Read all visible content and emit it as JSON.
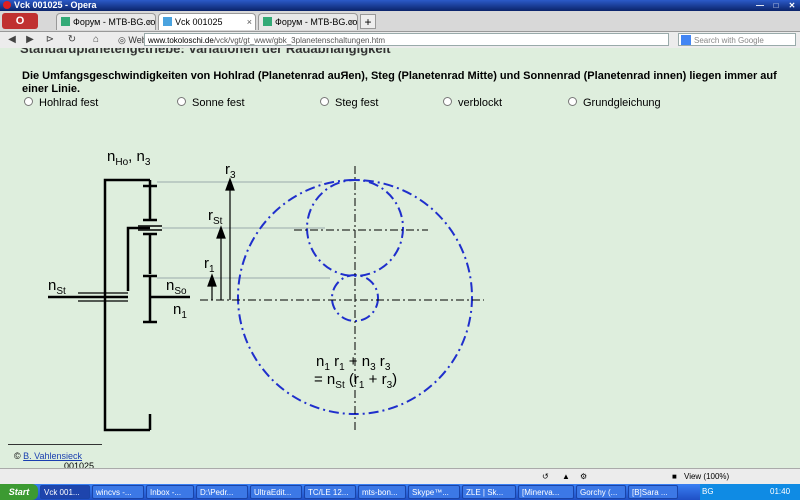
{
  "window": {
    "title": "Vck 001025 - Opera"
  },
  "tabs": [
    {
      "label": "Форум - MTB-BG.com • V..."
    },
    {
      "label": "Vck 001025"
    },
    {
      "label": "Форум - MTB-BG.com • V..."
    }
  ],
  "toolbar": {
    "opera_label": "O",
    "web_label": "Web",
    "address_host": "www.tokoloschi.de",
    "address_path": "/vck/vgt/gt_www/gbk_3planetenschaltungen.htm",
    "search_placeholder": "Search with Google"
  },
  "page": {
    "heading_cut": "Standardplanetengetriebe: Variationen der Radabhängigkeit",
    "paragraph": "Die Umfangsgeschwindigkeiten von Hohlrad (Planetenrad auЯen), Steg (Planetenrad Mitte) und Sonnenrad (Planetenrad innen) liegen immer auf einer Linie.",
    "options": [
      "Hohlrad fest",
      "Sonne fest",
      "Steg fest",
      "verblockt",
      "Grundgleichung"
    ],
    "diagram_labels": {
      "n_ho_base": "n",
      "n_ho_sub": "Ho",
      "n3_base": ", n",
      "n3_sub": "3",
      "n_st_base": "n",
      "n_st_sub": "St",
      "n_so_base": "n",
      "n_so_sub": "So",
      "n1_base": "n",
      "n1_sub": "1",
      "r3_base": "r",
      "r3_sub": "3",
      "rst_base": "r",
      "rst_sub": "St",
      "r1_base": "r",
      "r1_sub": "1"
    },
    "formula": {
      "line1": [
        "n",
        "1",
        " r",
        "1",
        " + n",
        "3",
        " r",
        "3"
      ],
      "line2": [
        "= n",
        "St",
        " (r",
        "1",
        " + r",
        "3",
        ")"
      ]
    },
    "credit_name": "B. Vahlensieck",
    "credit_number": "001025",
    "diagram_color": "#1f2fcc"
  },
  "statusbar": {
    "view_label": "View (100%)"
  },
  "taskbar": {
    "start_label": "Start",
    "items": [
      "Vck 001...",
      "wincvs -...",
      "Inbox -...",
      "D:\\Pedr...",
      "UltraEdit...",
      "TC/LE 12...",
      "mts-bon...",
      "Skype™...",
      "ZLE | Sk...",
      "[Minerva...",
      "Gorchy (...",
      "[B]Sara ..."
    ],
    "lang": "BG",
    "clock": "01:40"
  }
}
